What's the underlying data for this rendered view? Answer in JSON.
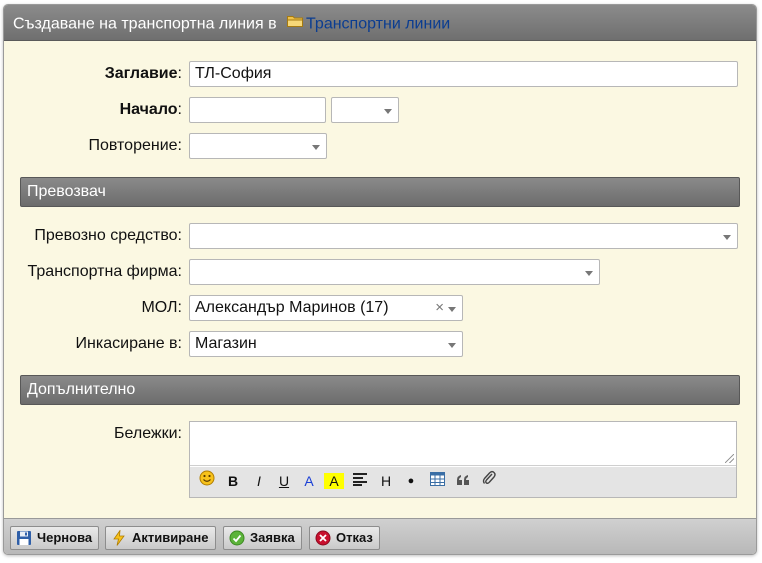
{
  "title": {
    "prefix": "Създаване на транспортна линия в",
    "folder_link": "Транспортни линии"
  },
  "form": {
    "title_label": "Заглавие",
    "title_value": "ТЛ-София",
    "start_label": "Начало",
    "start_date_value": "",
    "start_time_value": "",
    "repeat_label": "Повторение:",
    "repeat_value": ""
  },
  "sections": {
    "carrier": "Превозвач",
    "additional": "Допълнително"
  },
  "carrier": {
    "vehicle_label": "Превозно средство:",
    "vehicle_value": "",
    "company_label": "Транспортна фирма:",
    "company_value": "",
    "mol_label": "МОЛ:",
    "mol_value": "Александър Маринов (17)",
    "mol_clear": "×",
    "collect_label": "Инкасиране в:",
    "collect_value": "Магазин"
  },
  "notes": {
    "label": "Бележки:",
    "value": ""
  },
  "editor_toolbar": {
    "bold": "B",
    "italic": "I",
    "underline": "U",
    "font_color": "A",
    "highlight": "A",
    "heading": "H",
    "bullet": "●"
  },
  "buttons": {
    "draft": "Чернова",
    "activate": "Активиране",
    "request": "Заявка",
    "cancel": "Отказ"
  },
  "colors": {
    "form_background": "#fbf8e2",
    "header_gray": "#7d7d7d",
    "link_blue": "#0b3d91",
    "font_color_blue": "#1a3fd6",
    "highlight_yellow": "#ffff00"
  },
  "icons": [
    "folder-icon",
    "caret-down-icon",
    "clear-icon",
    "smiley-icon",
    "align-icon",
    "table-icon",
    "quote-icon",
    "attach-icon",
    "save-icon",
    "lightning-icon",
    "check-icon",
    "cancel-icon"
  ]
}
